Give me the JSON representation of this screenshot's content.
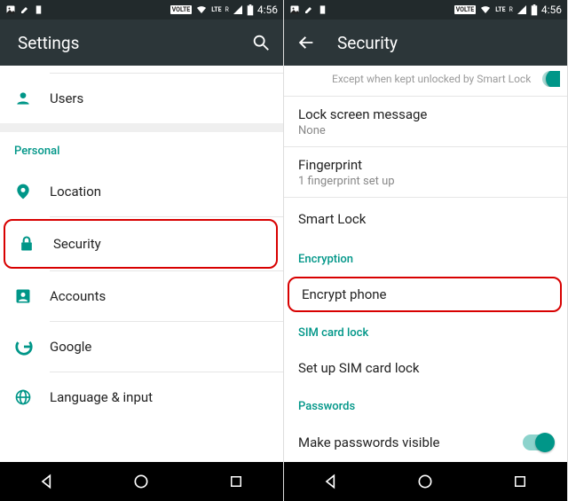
{
  "status": {
    "time": "4:56",
    "volte": "VOLTE",
    "lte": "LTE",
    "r": "R"
  },
  "left": {
    "title": "Settings",
    "users": "Users",
    "sectionPersonal": "Personal",
    "location": "Location",
    "security": "Security",
    "accounts": "Accounts",
    "google": "Google",
    "language": "Language & input"
  },
  "right": {
    "title": "Security",
    "smartlockHint": "Except when kept unlocked by Smart Lock",
    "lockMsg": {
      "title": "Lock screen message",
      "sub": "None"
    },
    "fingerprint": {
      "title": "Fingerprint",
      "sub": "1 fingerprint set up"
    },
    "smartLock": "Smart Lock",
    "encryptionHeader": "Encryption",
    "encryptPhone": "Encrypt phone",
    "simHeader": "SIM card lock",
    "simSetup": "Set up SIM card lock",
    "passwordsHeader": "Passwords",
    "pwVisible": "Make passwords visible"
  }
}
